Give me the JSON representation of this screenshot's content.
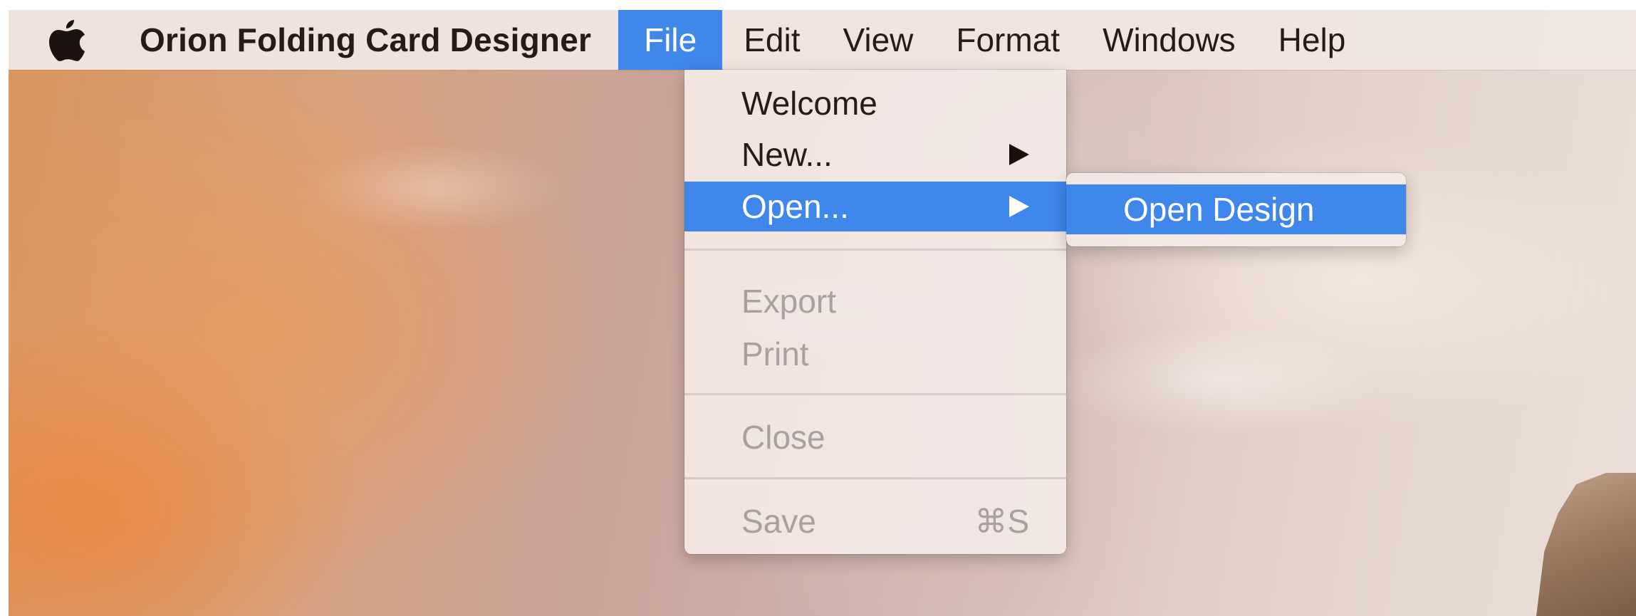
{
  "menubar": {
    "app_name": "Orion Folding Card Designer",
    "apple_icon": "apple-logo-icon",
    "menus": [
      {
        "label": "File",
        "active": true
      },
      {
        "label": "Edit",
        "active": false
      },
      {
        "label": "View",
        "active": false
      },
      {
        "label": "Format",
        "active": false
      },
      {
        "label": "Windows",
        "active": false
      },
      {
        "label": "Help",
        "active": false
      }
    ]
  },
  "file_menu": {
    "items": [
      {
        "label": "Welcome",
        "enabled": true
      },
      {
        "label": "New...",
        "enabled": true,
        "submenu_icon": "chevron-right-icon"
      },
      {
        "label": "Open...",
        "enabled": true,
        "highlighted": true,
        "submenu_icon": "chevron-right-icon"
      },
      {
        "label": "Export",
        "enabled": false
      },
      {
        "label": "Print",
        "enabled": false
      },
      {
        "label": "Close",
        "enabled": false
      },
      {
        "label": "Save",
        "enabled": false,
        "shortcut": "⌘S"
      }
    ]
  },
  "open_submenu": {
    "items": [
      {
        "label": "Open Design",
        "highlighted": true
      }
    ]
  },
  "colors": {
    "highlight": "#3f87eb",
    "menu_text": "#2a1a14",
    "disabled_text": "#a8a19d"
  }
}
